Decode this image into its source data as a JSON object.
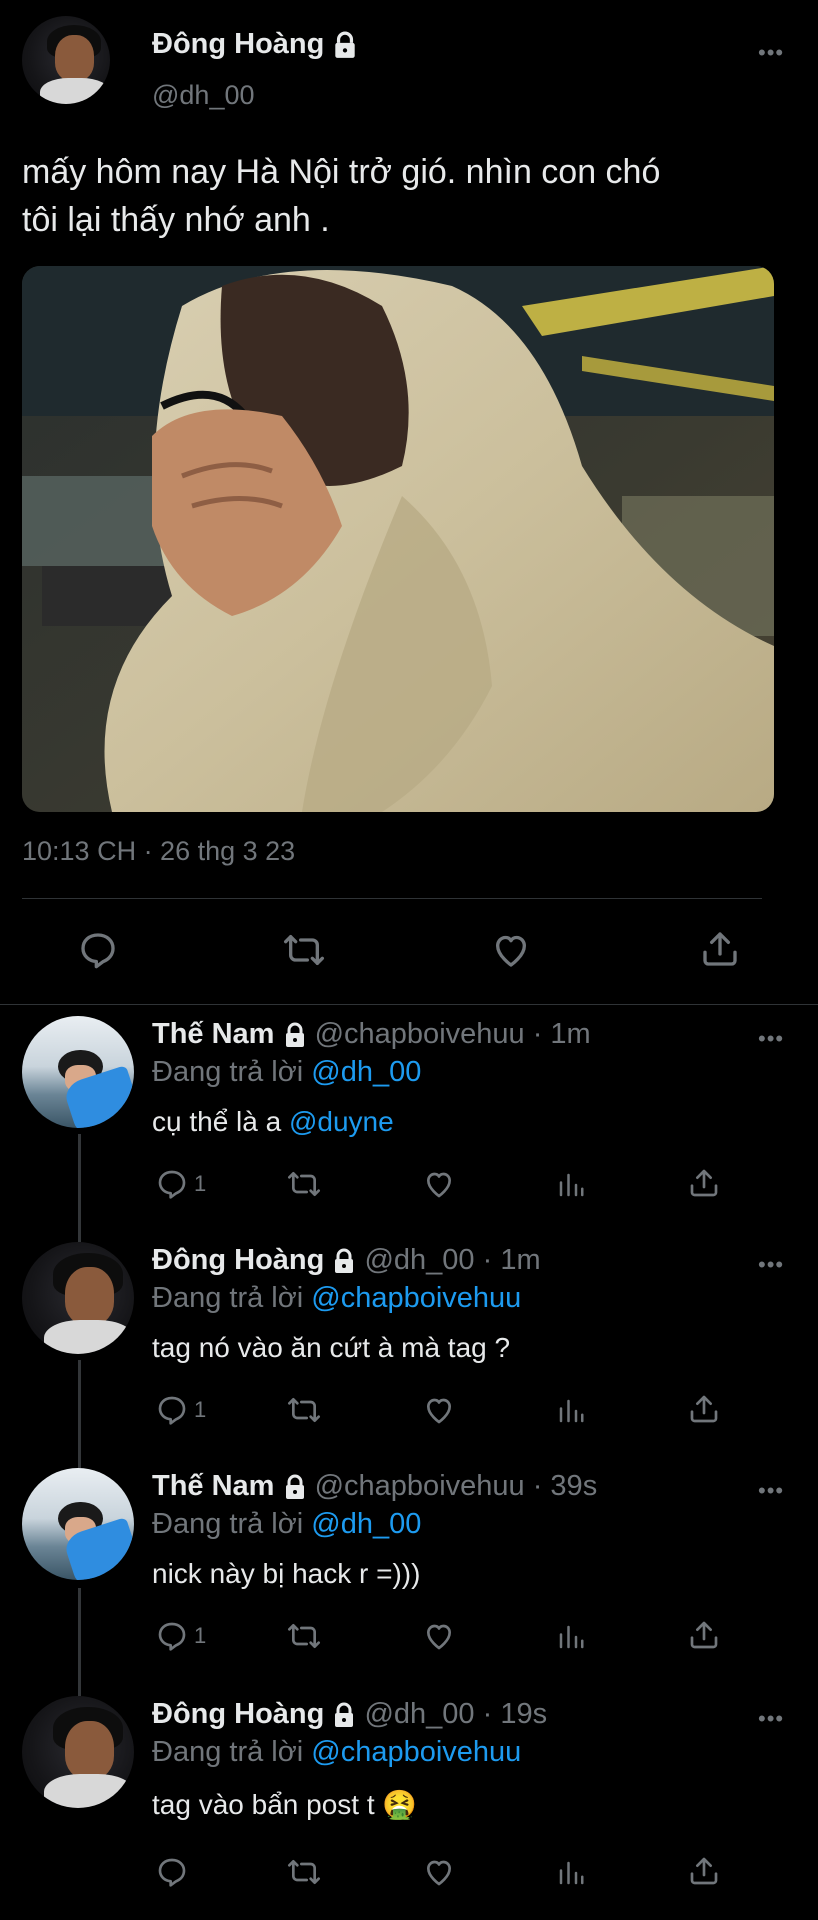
{
  "main_tweet": {
    "author_name": "Đông Hoàng",
    "author_handle": "@dh_00",
    "text_line1": "mấy hôm nay Hà Nội trở gió. nhìn con chó",
    "text_line2": "tôi lại thấy nhớ anh .",
    "timestamp": "10:13 CH · 26 thg 3 23",
    "icons": {
      "reply": "reply-icon",
      "retweet": "retweet-icon",
      "like": "heart-icon",
      "share": "share-icon"
    }
  },
  "replies": [
    {
      "author_name": "Thế Nam",
      "author_handle": "@chapboivehuu",
      "time": "· 1m",
      "replying_prefix": "Đang trả lời",
      "replying_to": "@dh_00",
      "text_before": "cụ thể là a ",
      "text_mention": "@duyne",
      "reply_count": "1"
    },
    {
      "author_name": "Đông Hoàng",
      "author_handle": "@dh_00",
      "time": "· 1m",
      "replying_prefix": "Đang trả lời",
      "replying_to": "@chapboivehuu",
      "text_before": "tag nó vào ăn cứt à mà tag ?",
      "text_mention": "",
      "reply_count": "1"
    },
    {
      "author_name": "Thế Nam",
      "author_handle": "@chapboivehuu",
      "time": "· 39s",
      "replying_prefix": "Đang trả lời",
      "replying_to": "@dh_00",
      "text_before": "nick này bị hack r =)))",
      "text_mention": "",
      "reply_count": "1"
    },
    {
      "author_name": "Đông Hoàng",
      "author_handle": "@dh_00",
      "time": "· 19s",
      "replying_prefix": "Đang trả lời",
      "replying_to": "@chapboivehuu",
      "text_before": "tag vào bẩn post t ",
      "text_mention": "",
      "emoji": "🤮",
      "reply_count": ""
    }
  ],
  "more_label": "•••",
  "colors": {
    "background": "#000000",
    "text": "#e7e9ea",
    "muted": "#71767b",
    "accent": "#1d9bf0"
  }
}
